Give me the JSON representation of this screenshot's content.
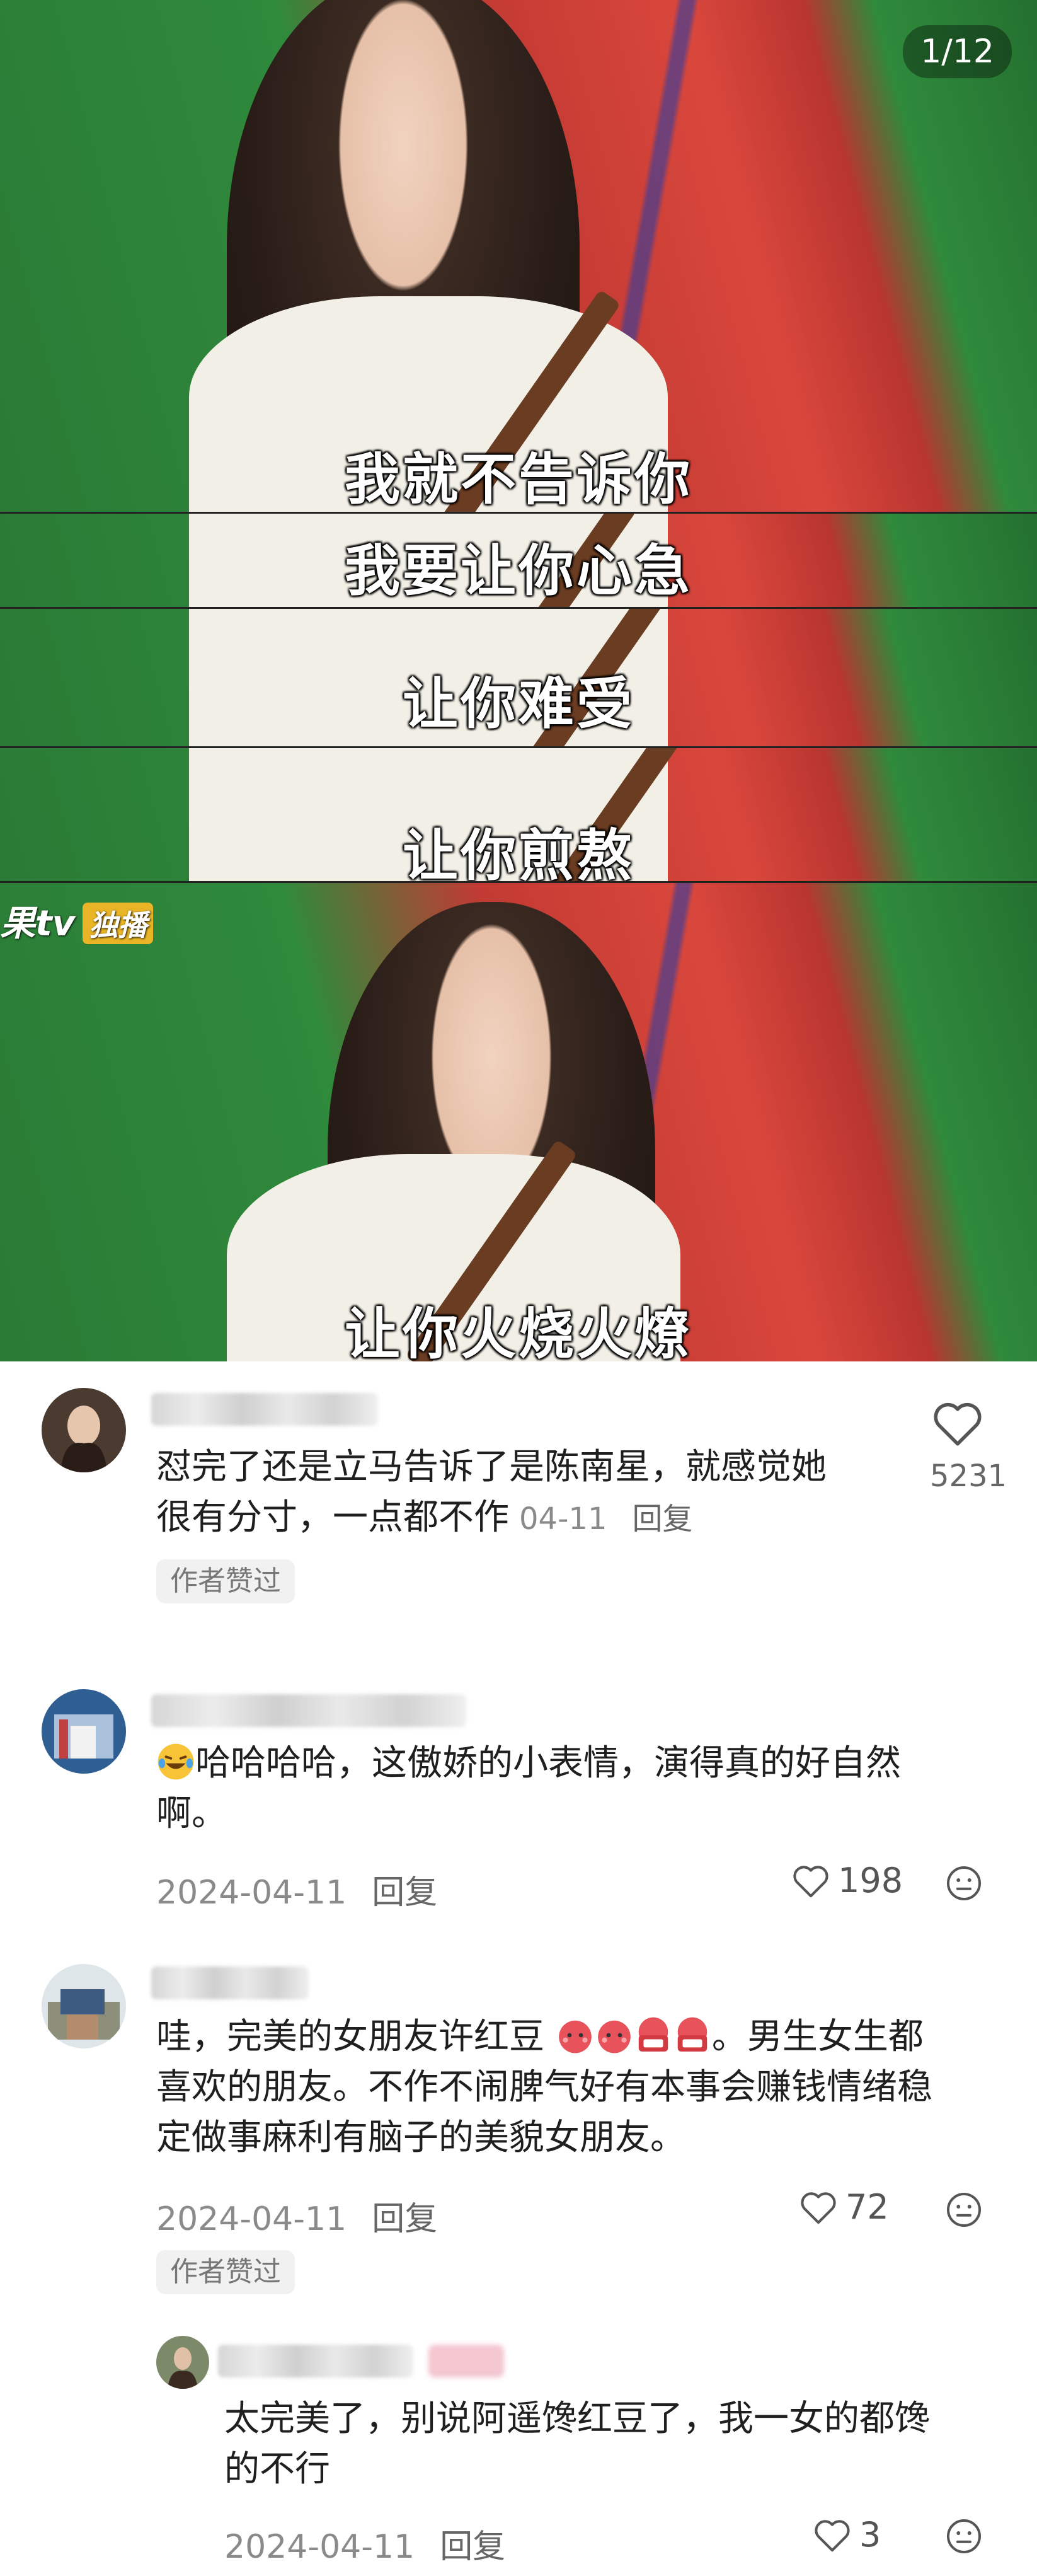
{
  "media": {
    "page_counter": "1/12",
    "captions": [
      "我就不告诉你",
      "我要让你心急",
      "让你难受",
      "让你煎熬",
      "让你火烧火燎"
    ],
    "watermark": {
      "brand": "果tv",
      "tag": "独播"
    }
  },
  "comments": [
    {
      "text_line1": "怼完了还是立马告诉了是陈南星，就感觉她",
      "text_line2": "很有分寸，一点都不作",
      "date": "04-11",
      "reply_label": "回复",
      "likes": "5231",
      "author_liked": "作者赞过"
    },
    {
      "text_line1": "哈哈哈哈，这傲娇的小表情，演得真的好自然",
      "text_line2": "啊。",
      "date": "2024-04-11",
      "reply_label": "回复",
      "likes": "198"
    },
    {
      "text_line1_a": "哇，完美的女朋友许红豆",
      "text_line1_b": "。男生女生都",
      "text_line2": "喜欢的朋友。不作不闹脾气好有本事会赚钱情绪稳",
      "text_line3": "定做事麻利有脑子的美貌女朋友。",
      "date": "2024-04-11",
      "reply_label": "回复",
      "likes": "72",
      "author_liked": "作者赞过"
    },
    {
      "text_line1": "太完美了，别说阿遥馋红豆了，我一女的都馋",
      "text_line2": "的不行",
      "date": "2024-04-11",
      "reply_label": "回复",
      "likes": "3"
    }
  ],
  "colors": {
    "accent_strap": "#6a3c22",
    "caption": "#ffffff",
    "meta_gray": "#8a8a8a"
  }
}
